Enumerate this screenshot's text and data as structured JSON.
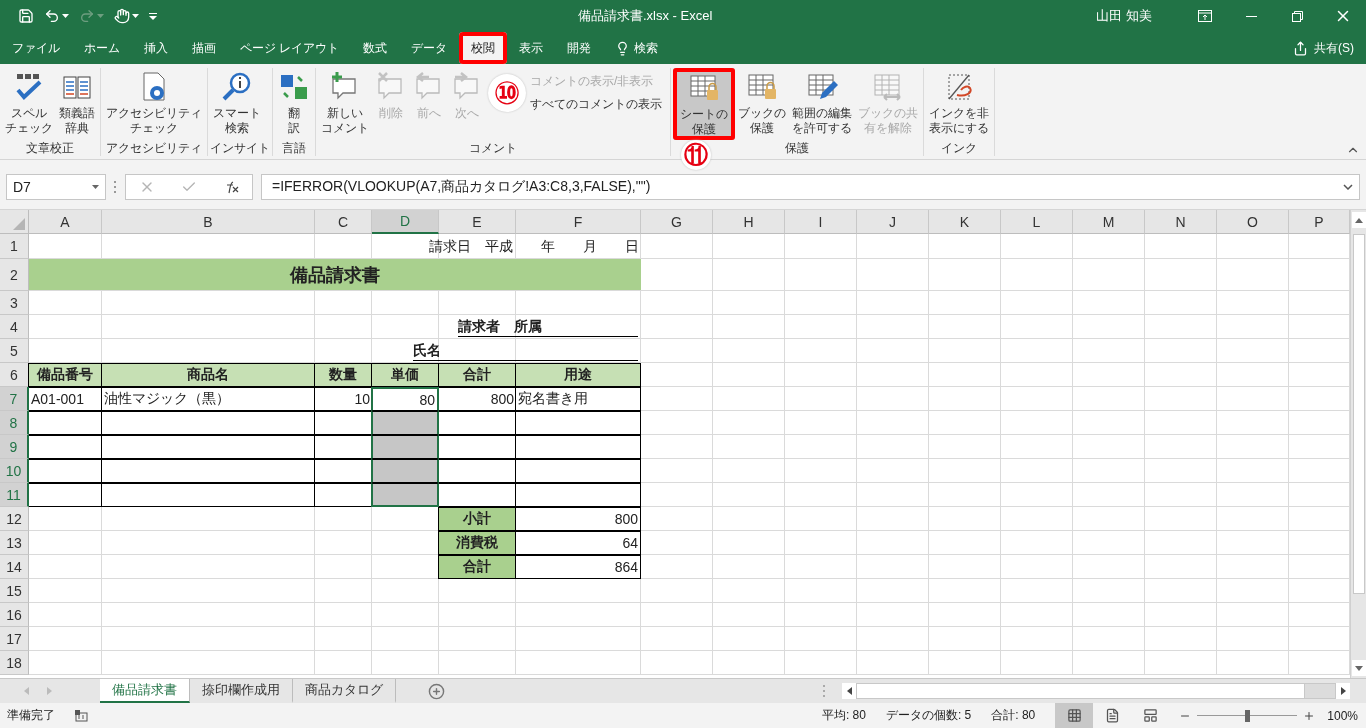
{
  "window": {
    "title": "備品請求書.xlsx  -  Excel",
    "user": "山田 知美"
  },
  "menu_tabs": [
    {
      "label": "ファイル",
      "selected": false,
      "marked": false
    },
    {
      "label": "ホーム",
      "selected": false,
      "marked": false
    },
    {
      "label": "挿入",
      "selected": false,
      "marked": false
    },
    {
      "label": "描画",
      "selected": false,
      "marked": false
    },
    {
      "label": "ページ レイアウト",
      "selected": false,
      "marked": false
    },
    {
      "label": "数式",
      "selected": false,
      "marked": false
    },
    {
      "label": "データ",
      "selected": false,
      "marked": false
    },
    {
      "label": "校閲",
      "selected": true,
      "marked": true
    },
    {
      "label": "表示",
      "selected": false,
      "marked": false
    },
    {
      "label": "開発",
      "selected": false,
      "marked": false
    }
  ],
  "search": {
    "label": "検索"
  },
  "share": {
    "label": "共有(S)"
  },
  "ribbon_groups": [
    {
      "label": "文章校正",
      "buttons": [
        {
          "lines": [
            "スペル",
            "チェック"
          ],
          "disabled": false,
          "marked": false
        },
        {
          "lines": [
            "類義語",
            "辞典"
          ],
          "disabled": false,
          "marked": false
        }
      ]
    },
    {
      "label": "アクセシビリティ",
      "buttons": [
        {
          "lines": [
            "アクセシビリティ",
            "チェック"
          ],
          "disabled": false,
          "marked": false
        }
      ]
    },
    {
      "label": "インサイト",
      "buttons": [
        {
          "lines": [
            "スマート",
            "検索"
          ],
          "disabled": false,
          "marked": false
        }
      ]
    },
    {
      "label": "言語",
      "buttons": [
        {
          "lines": [
            "翻",
            "訳"
          ],
          "disabled": false,
          "marked": false
        }
      ]
    },
    {
      "label": "コメント",
      "buttons": [
        {
          "lines": [
            "新しい",
            "コメント"
          ],
          "disabled": false,
          "marked": false
        },
        {
          "lines": [
            "削除"
          ],
          "disabled": true,
          "marked": false
        },
        {
          "lines": [
            "前へ"
          ],
          "disabled": true,
          "marked": false
        },
        {
          "lines": [
            "次へ"
          ],
          "disabled": true,
          "marked": false
        }
      ],
      "small_buttons": [
        {
          "label": "コメントの表示/非表示",
          "disabled": true
        },
        {
          "label": "すべてのコメントの表示",
          "disabled": false
        }
      ]
    },
    {
      "label": "保護",
      "buttons": [
        {
          "lines": [
            "シートの",
            "保護"
          ],
          "disabled": false,
          "marked": true
        },
        {
          "lines": [
            "ブックの",
            "保護"
          ],
          "disabled": false,
          "marked": false
        },
        {
          "lines": [
            "範囲の編集",
            "を許可する"
          ],
          "disabled": false,
          "marked": false
        },
        {
          "lines": [
            "ブックの共",
            "有を解除"
          ],
          "disabled": true,
          "marked": false
        }
      ]
    },
    {
      "label": "インク",
      "buttons": [
        {
          "lines": [
            "インクを非",
            "表示にする"
          ],
          "disabled": false,
          "marked": false
        }
      ]
    }
  ],
  "annotations": [
    {
      "label": "⑩"
    },
    {
      "label": "⑪"
    }
  ],
  "formula_bar": {
    "name_box": "D7",
    "formula": "=IFERROR(VLOOKUP(A7,商品カタログ!A3:C8,3,FALSE),\"\")"
  },
  "columns": [
    {
      "label": "A",
      "selected": false
    },
    {
      "label": "B",
      "selected": false
    },
    {
      "label": "C",
      "selected": false
    },
    {
      "label": "D",
      "selected": true
    },
    {
      "label": "E",
      "selected": false
    },
    {
      "label": "F",
      "selected": false
    },
    {
      "label": "G",
      "selected": false
    },
    {
      "label": "H",
      "selected": false
    },
    {
      "label": "I",
      "selected": false
    },
    {
      "label": "J",
      "selected": false
    },
    {
      "label": "K",
      "selected": false
    },
    {
      "label": "L",
      "selected": false
    },
    {
      "label": "M",
      "selected": false
    },
    {
      "label": "N",
      "selected": false
    },
    {
      "label": "O",
      "selected": false
    },
    {
      "label": "P",
      "selected": false
    }
  ],
  "rows": [
    {
      "label": "1",
      "kind": "date",
      "selected": false,
      "cells": [
        "請求日　平成　　年　　月　　日"
      ]
    },
    {
      "label": "2",
      "kind": "title",
      "selected": false,
      "cells": [
        "備品請求書"
      ]
    },
    {
      "label": "3",
      "kind": "blank",
      "selected": false
    },
    {
      "label": "4",
      "kind": "requester",
      "selected": false,
      "cells": [
        "請求者　所属"
      ]
    },
    {
      "label": "5",
      "kind": "name",
      "selected": false,
      "cells": [
        "氏名"
      ]
    },
    {
      "label": "6",
      "kind": "header",
      "selected": false,
      "cells": [
        "備品番号",
        "商品名",
        "数量",
        "単価",
        "合計",
        "用途"
      ]
    },
    {
      "label": "7",
      "kind": "item",
      "selected": true,
      "cells": [
        "A01-001",
        "油性マジック（黒）",
        "10",
        "80",
        "800",
        "宛名書き用"
      ]
    },
    {
      "label": "8",
      "kind": "item",
      "selected": true
    },
    {
      "label": "9",
      "kind": "item",
      "selected": true
    },
    {
      "label": "10",
      "kind": "item",
      "selected": true
    },
    {
      "label": "11",
      "kind": "item",
      "selected": true
    },
    {
      "label": "12",
      "kind": "summary",
      "selected": false,
      "cells": [
        "小計",
        "800"
      ]
    },
    {
      "label": "13",
      "kind": "summary",
      "selected": false,
      "cells": [
        "消費税",
        "64"
      ]
    },
    {
      "label": "14",
      "kind": "summary",
      "selected": false,
      "cells": [
        "合計",
        "864"
      ]
    },
    {
      "label": "15",
      "kind": "blank",
      "selected": false
    },
    {
      "label": "16",
      "kind": "blank",
      "selected": false
    },
    {
      "label": "17",
      "kind": "blank",
      "selected": false
    },
    {
      "label": "18",
      "kind": "blank",
      "selected": false
    }
  ],
  "sheet_tabs": [
    {
      "label": "備品請求書",
      "selected": true
    },
    {
      "label": "捺印欄作成用",
      "selected": false
    },
    {
      "label": "商品カタログ",
      "selected": false
    }
  ],
  "status": {
    "mode": "準備完了",
    "stats": [
      "平均: 80",
      "データの個数: 5",
      "合計: 80"
    ],
    "views": [
      {
        "selected": true
      },
      {
        "selected": false
      },
      {
        "selected": false
      }
    ],
    "zoom": {
      "level": 0.5,
      "label": "100%"
    }
  }
}
